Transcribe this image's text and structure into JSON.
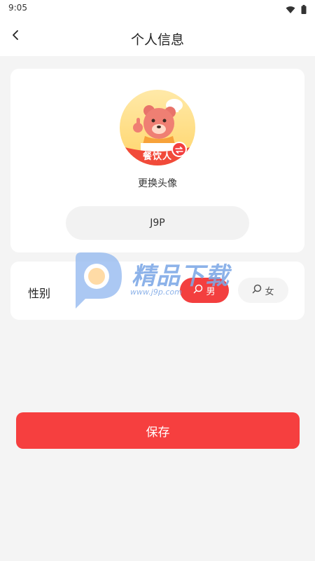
{
  "status_bar": {
    "time": "9:05",
    "icons": [
      "wifi-icon",
      "battery-icon"
    ]
  },
  "nav": {
    "title": "个人信息",
    "back_icon": "chevron-left-icon"
  },
  "profile": {
    "avatar_text": "餐饮人",
    "change_avatar_label": "更换头像",
    "nickname": "J9P"
  },
  "gender": {
    "label": "性别",
    "options": [
      {
        "label": "男",
        "icon": "male-icon",
        "selected": true
      },
      {
        "label": "女",
        "icon": "female-icon",
        "selected": false
      }
    ]
  },
  "save_label": "保存",
  "watermark": {
    "title": "精品下载",
    "url": "www.j9p.com"
  },
  "colors": {
    "accent": "#f63f3f",
    "background": "#f4f4f4",
    "card": "#ffffff"
  }
}
